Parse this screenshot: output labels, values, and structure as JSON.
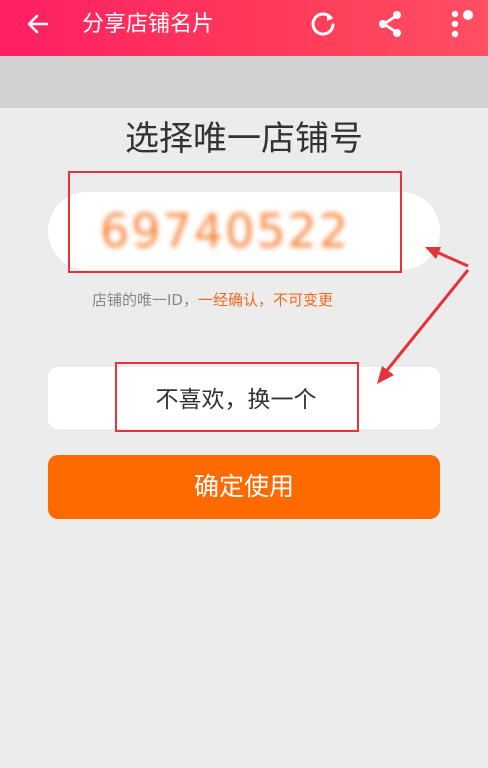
{
  "header": {
    "title": "分享店铺名片",
    "back_icon": "arrow-left-icon",
    "refresh_icon": "refresh-icon",
    "share_icon": "share-icon",
    "more_icon": "more-vertical-icon"
  },
  "main": {
    "title": "选择唯一店铺号",
    "shop_number": "69740522",
    "hint_prefix": "店铺的唯一ID，",
    "hint_warning": "一经确认，不可变更",
    "change_button": "不喜欢，换一个",
    "confirm_button": "确定使用"
  },
  "colors": {
    "header_gradient_start": "#ff1f63",
    "accent_orange": "#ff6a00",
    "annotation_red": "#e2343a"
  }
}
